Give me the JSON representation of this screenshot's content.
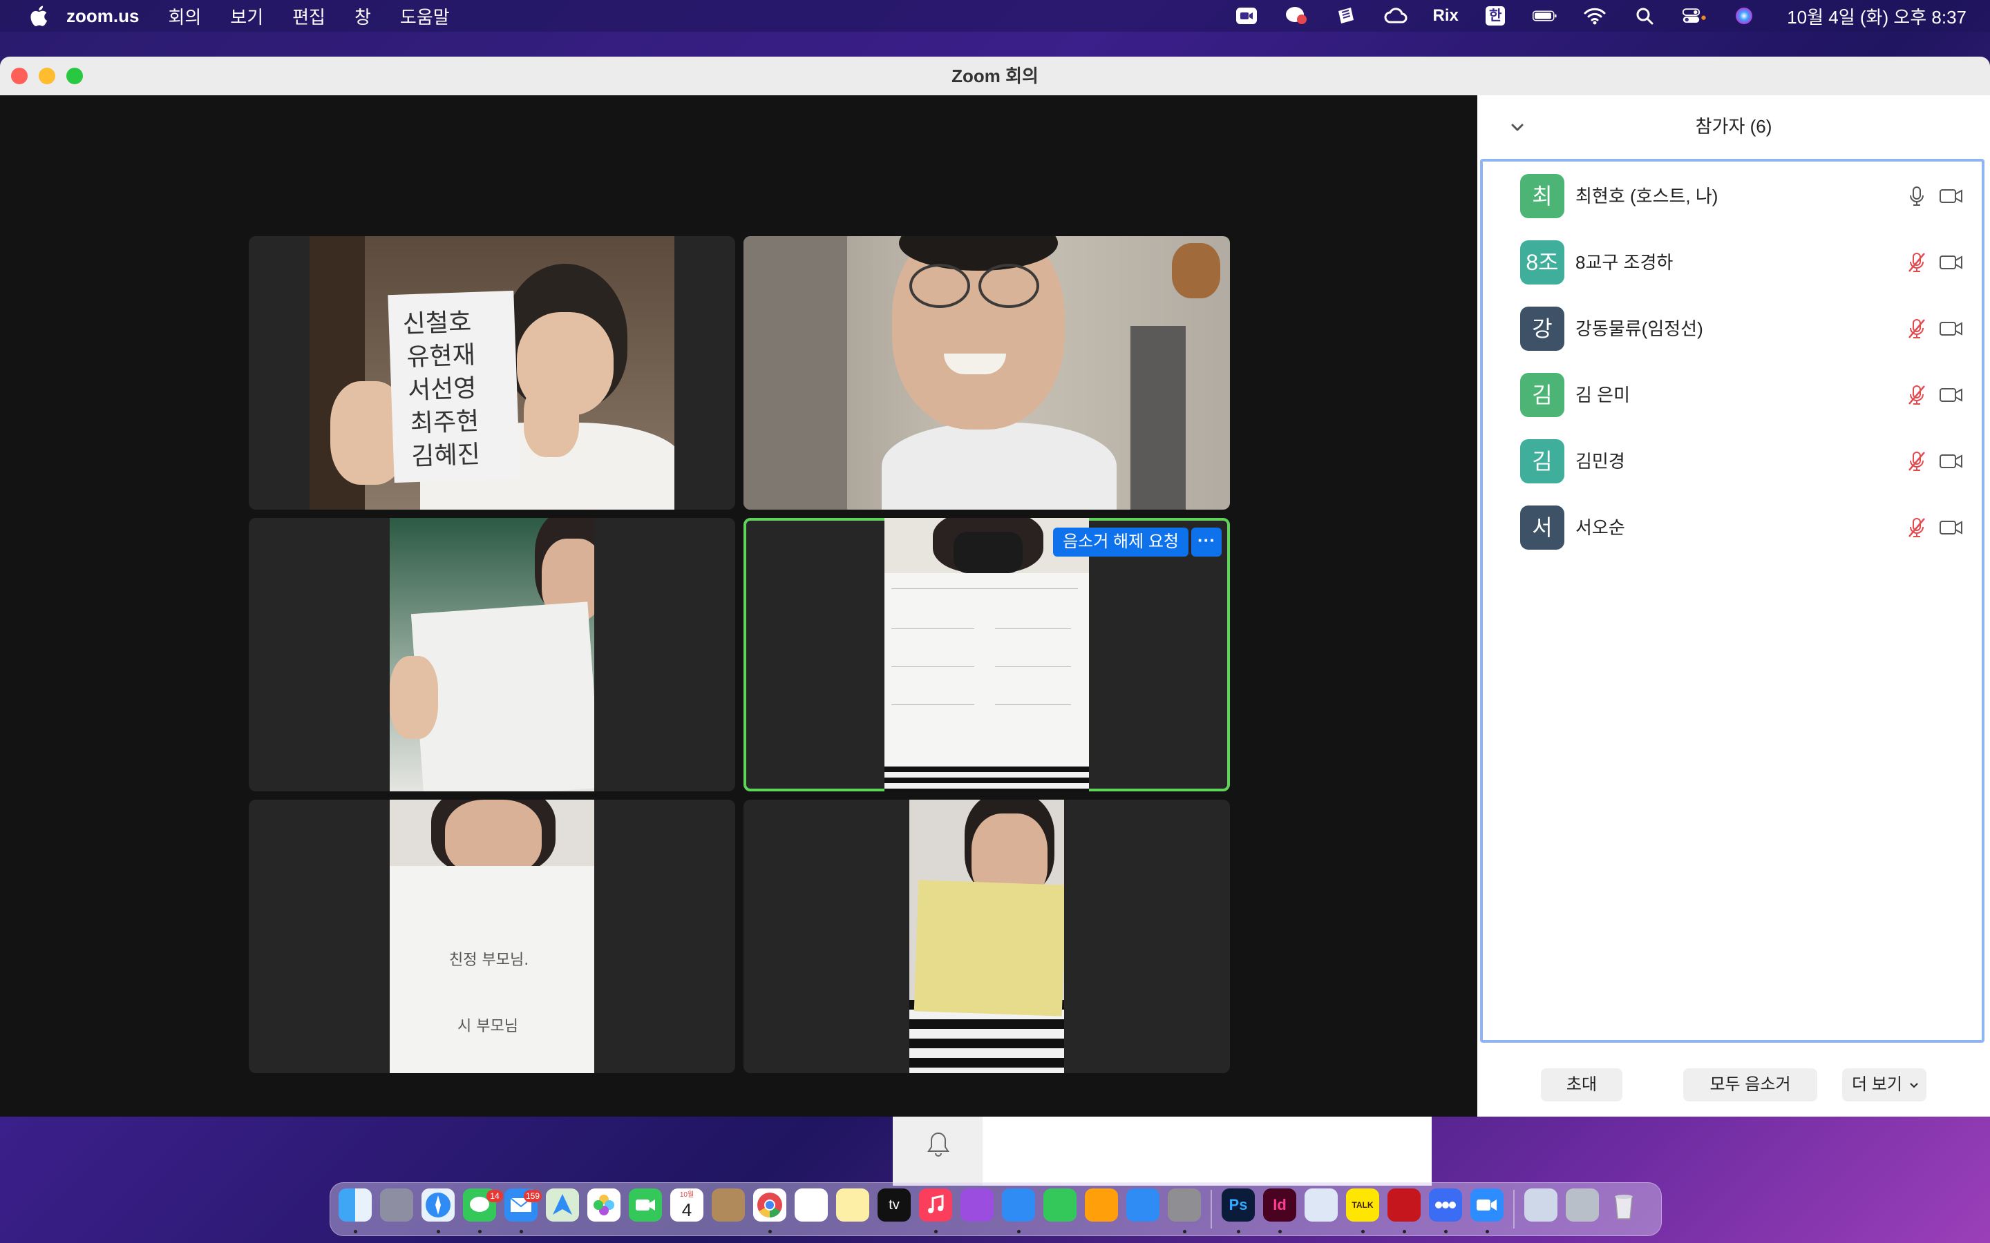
{
  "menubar": {
    "app_name": "zoom.us",
    "items": [
      "회의",
      "보기",
      "편집",
      "창",
      "도움말"
    ],
    "status_text": "Rix",
    "ime_label": "한",
    "clock": "10월 4일 (화) 오후 8:37"
  },
  "window": {
    "title": "Zoom 회의"
  },
  "video": {
    "tiles": [
      {
        "handwritten": [
          "신철호",
          "유현재",
          "서선영",
          "최주현",
          "김혜진"
        ]
      },
      {},
      {},
      {
        "unmute_label": "음소거 해제 요청",
        "more_label": "···",
        "active": true
      },
      {
        "handwritten": [
          "친정 부모님.",
          "시 부모님"
        ]
      },
      {}
    ]
  },
  "participants": {
    "title": "참가자 (6)",
    "list": [
      {
        "initial": "최",
        "name": "최현호 (호스트, 나)",
        "color": "#4cb575",
        "muted": false
      },
      {
        "initial": "8조",
        "name": "8교구 조경하",
        "color": "#3fae9b",
        "muted": true
      },
      {
        "initial": "강",
        "name": "강동물류(임정선)",
        "color": "#3d5266",
        "muted": true
      },
      {
        "initial": "김",
        "name": "김 은미",
        "color": "#4cb575",
        "muted": true
      },
      {
        "initial": "김",
        "name": "김민경",
        "color": "#3fae9b",
        "muted": true
      },
      {
        "initial": "서",
        "name": "서오순",
        "color": "#3d5266",
        "muted": true
      }
    ],
    "footer": {
      "invite": "초대",
      "mute_all": "모두 음소거",
      "more": "더 보기"
    }
  },
  "dock": {
    "messages_badge": "14",
    "mail_badge": "159",
    "calendar_month": "10월",
    "calendar_day": "4",
    "tv_label": "tv",
    "ps_label": "Ps",
    "id_label": "Id",
    "talk_label": "TALK"
  },
  "colors": {
    "zoom_blue": "#0e72ed",
    "active_speaker": "#5fd35a",
    "muted_red": "#e5484d"
  }
}
